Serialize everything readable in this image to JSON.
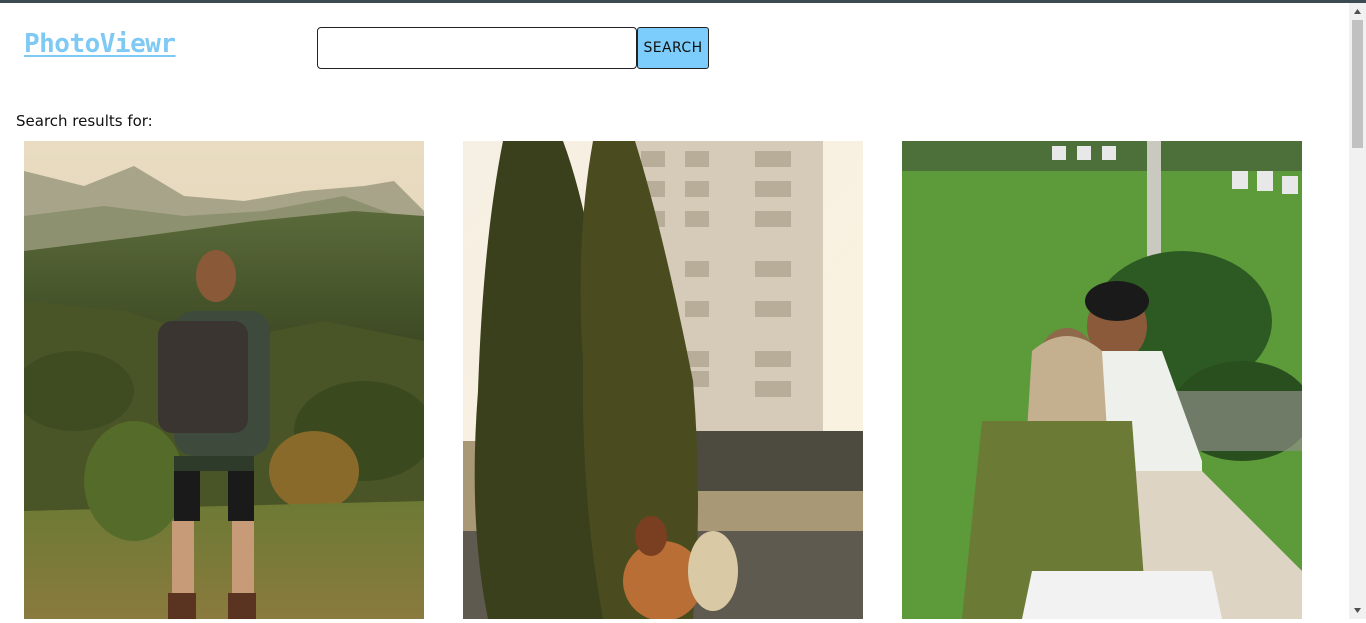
{
  "app": {
    "logo": "PhotoViewr"
  },
  "search": {
    "value": "",
    "placeholder": "",
    "button_label": "SEARCH"
  },
  "results": {
    "label": "Search results for:",
    "photos": [
      {
        "name": "photo-hiker-mountains"
      },
      {
        "name": "photo-building-trees"
      },
      {
        "name": "photo-couple-grass"
      }
    ]
  },
  "colors": {
    "accent": "#7ccdfb",
    "logo": "#7fc9f5",
    "topbar": "#3c4a52"
  }
}
